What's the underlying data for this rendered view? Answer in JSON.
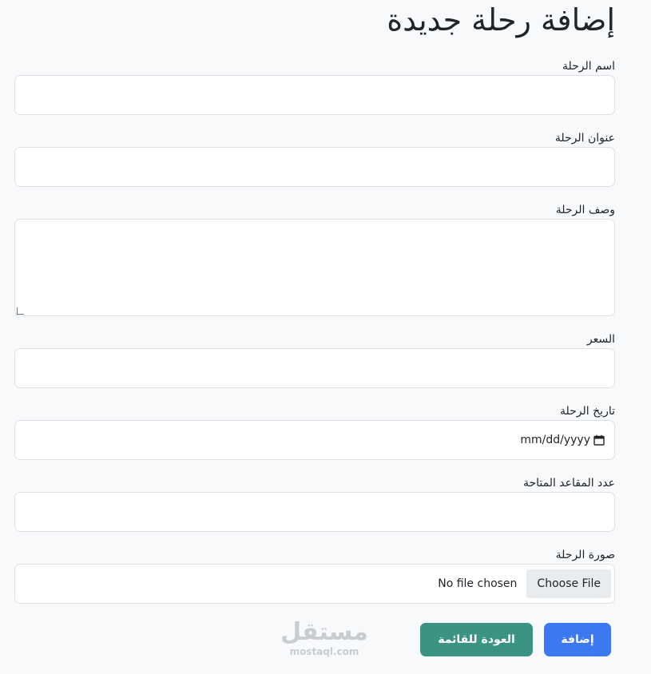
{
  "page": {
    "title": "إضافة رحلة جديدة"
  },
  "form": {
    "name_label": "اسم الرحلة",
    "title_label": "عنوان الرحلة",
    "description_label": "وصف الرحلة",
    "price_label": "السعر",
    "date_label": "تاريخ الرحلة",
    "date_placeholder": "mm/dd/yyyy",
    "seats_label": "عدد المقاعد المتاحة",
    "image_label": "صورة الرحلة",
    "choose_file_label": "Choose File",
    "no_file_text": "No file chosen"
  },
  "actions": {
    "add_label": "إضافة",
    "back_label": "العودة للقائمة",
    "add_color": "#3c78f0",
    "back_color": "#3b9383"
  },
  "watermark": {
    "logo_text": "مستقل",
    "url_text": "mostaql.com"
  }
}
